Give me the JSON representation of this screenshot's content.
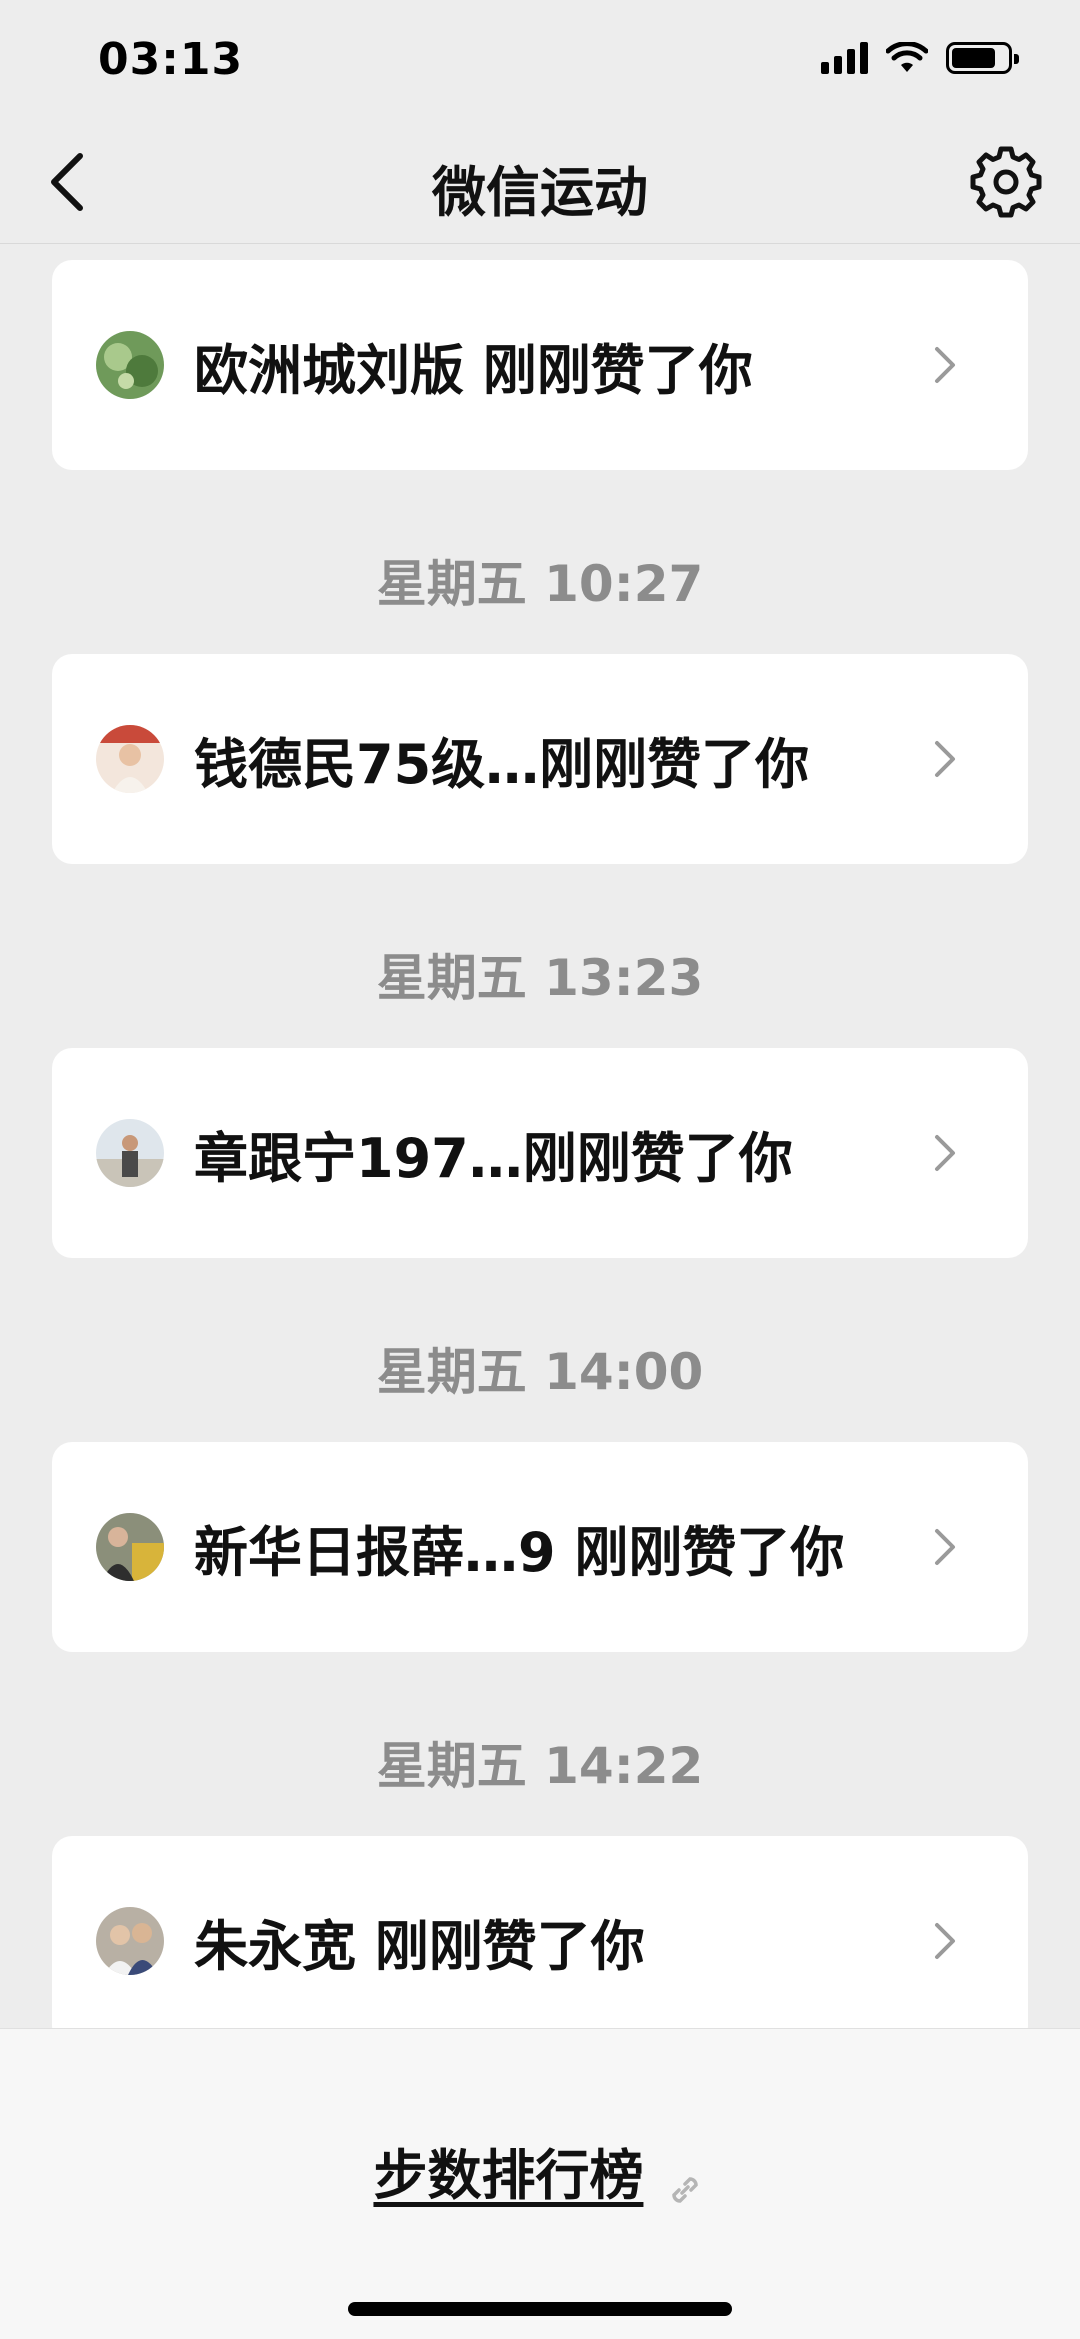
{
  "status_bar": {
    "time": "03:13",
    "battery_level": 0.8,
    "icons": [
      "signal-icon",
      "wifi-icon",
      "battery-icon"
    ]
  },
  "nav": {
    "title": "微信运动",
    "back_icon": "chevron-left-icon",
    "settings_icon": "gear-icon"
  },
  "items": [
    {
      "timestamp": "",
      "text": "欧洲城刘版 刚刚赞了你",
      "avatar": "avatar-icon"
    },
    {
      "timestamp": "星期五 10:27",
      "text": "钱德民75级…刚刚赞了你",
      "avatar": "avatar-icon"
    },
    {
      "timestamp": "星期五 13:23",
      "text": "章跟宁197…刚刚赞了你",
      "avatar": "avatar-icon"
    },
    {
      "timestamp": "星期五 14:00",
      "text": "新华日报薛…9 刚刚赞了你",
      "avatar": "avatar-icon"
    },
    {
      "timestamp": "星期五 14:22",
      "text": "朱永宽 刚刚赞了你",
      "avatar": "avatar-icon"
    }
  ],
  "bottom": {
    "rank_label": "步数排行榜",
    "link_icon": "link-icon"
  },
  "colors": {
    "background": "#ededed",
    "card": "#ffffff",
    "timestamp": "#8c8c8c",
    "text": "#111111"
  }
}
